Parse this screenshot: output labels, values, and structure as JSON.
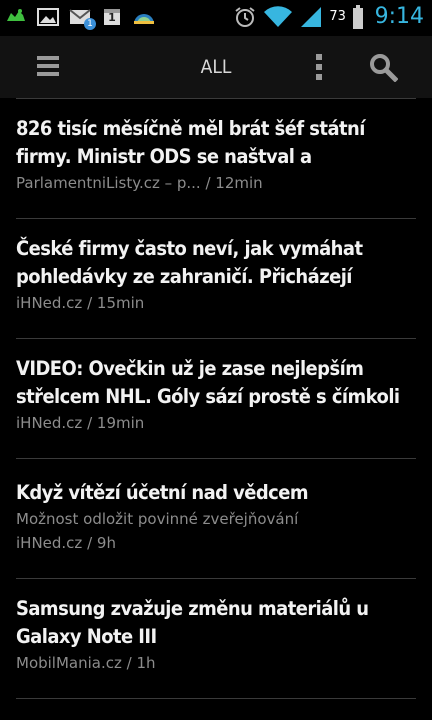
{
  "status_bar": {
    "icons": [
      "android-icon",
      "image-icon",
      "gmail-icon",
      "calendar-icon",
      "weather-icon"
    ],
    "calendar_day": "1",
    "gmail_badge": "1",
    "alarm_icon": "alarm-icon",
    "wifi_icon": "wifi-icon",
    "signal_icon": "signal-icon",
    "battery": "73",
    "time": "9:14"
  },
  "action_bar": {
    "title": "ALL",
    "menu_icon": "hamburger-menu-icon",
    "overflow_icon": "overflow-menu-icon",
    "search_icon": "search-icon"
  },
  "articles": [
    {
      "title_line1": "826 tisíc měsíčně měl brát šéf státní",
      "title_line2": "firmy. Ministr ODS se naštval a",
      "meta1": "ParlamentniListy.cz – p... /  12min"
    },
    {
      "title_line1": "České firmy často neví, jak vymáhat",
      "title_line2": "pohledávky ze zahraničí. Přicházejí",
      "meta1": "iHNed.cz /  15min"
    },
    {
      "title_line1": "VIDEO: Ovečkin už je zase nejlepším",
      "title_line2": "střelcem NHL. Góly sází prostě s čímkoli",
      "meta1": "iHNed.cz /  19min"
    },
    {
      "title_line1": "Když vítězí účetní nad vědcem",
      "meta1": "Možnost odložit povinné zveřejňování",
      "meta2": "iHNed.cz / 9h"
    },
    {
      "title_line1": "Samsung zvažuje změnu materiálů u",
      "title_line2": "Galaxy Note III",
      "meta1": "MobilMania.cz / 1h"
    }
  ],
  "colors": {
    "clock": "#37b6e0",
    "headline": "#f2f2f2",
    "meta": "#8c8c8c",
    "divider": "#3a3a3a"
  }
}
